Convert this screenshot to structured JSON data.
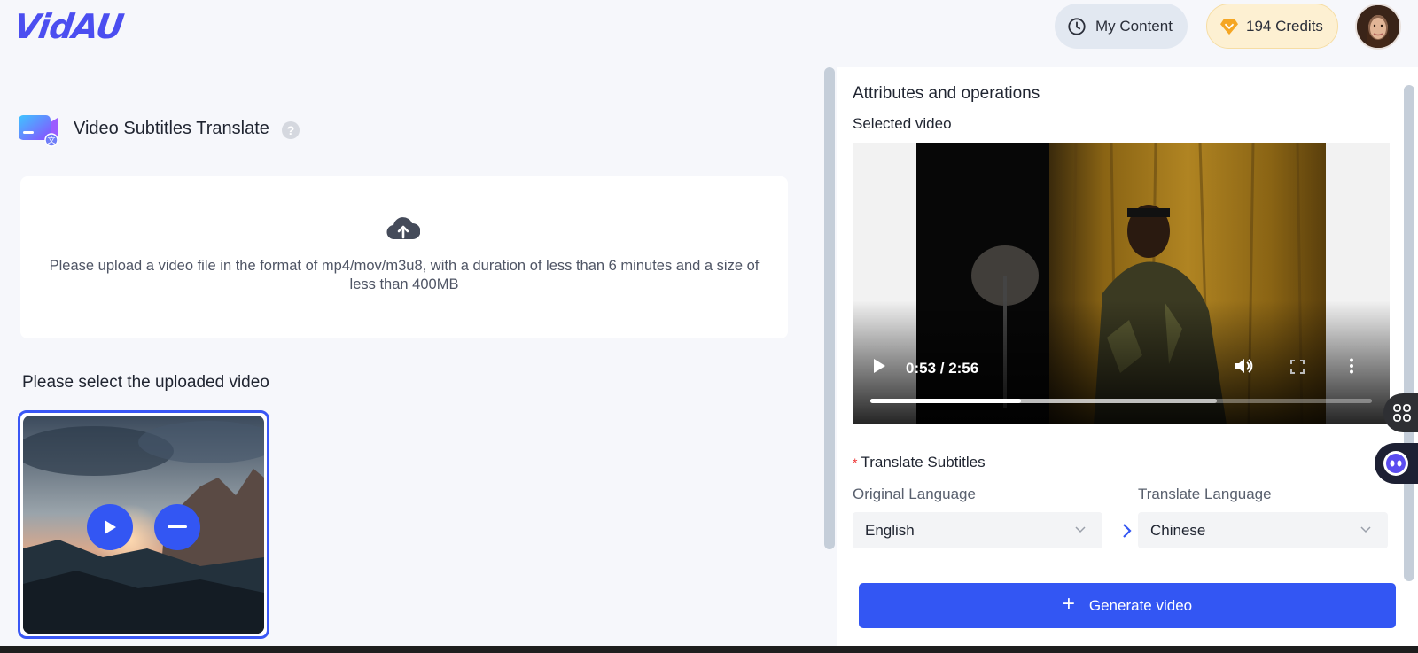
{
  "header": {
    "logo": "VidAU",
    "my_content_label": "My Content",
    "credits_label": "194 Credits"
  },
  "tool": {
    "title": "Video Subtitles Translate",
    "help": "?"
  },
  "upload": {
    "instructions": "Please upload a video file in the format of mp4/mov/m3u8, with a duration of less than 6 minutes and a size of less than 400MB"
  },
  "uploaded": {
    "label": "Please select the uploaded video"
  },
  "panel": {
    "title": "Attributes and operations",
    "selected_video_label": "Selected video",
    "player": {
      "time": "0:53 / 2:56",
      "played_fraction": 0.3,
      "buffered_fraction": 0.69
    },
    "translate_label": "Translate Subtitles",
    "required_mark": "*",
    "original_language_label": "Original Language",
    "translate_language_label": "Translate Language",
    "original_language_value": "English",
    "translate_language_value": "Chinese",
    "generate_label": "Generate video",
    "generate_plus": "+"
  },
  "colors": {
    "accent": "#3356f3",
    "credits_bg": "#fdf0d2",
    "content_pill_bg": "#e2e8f1"
  }
}
